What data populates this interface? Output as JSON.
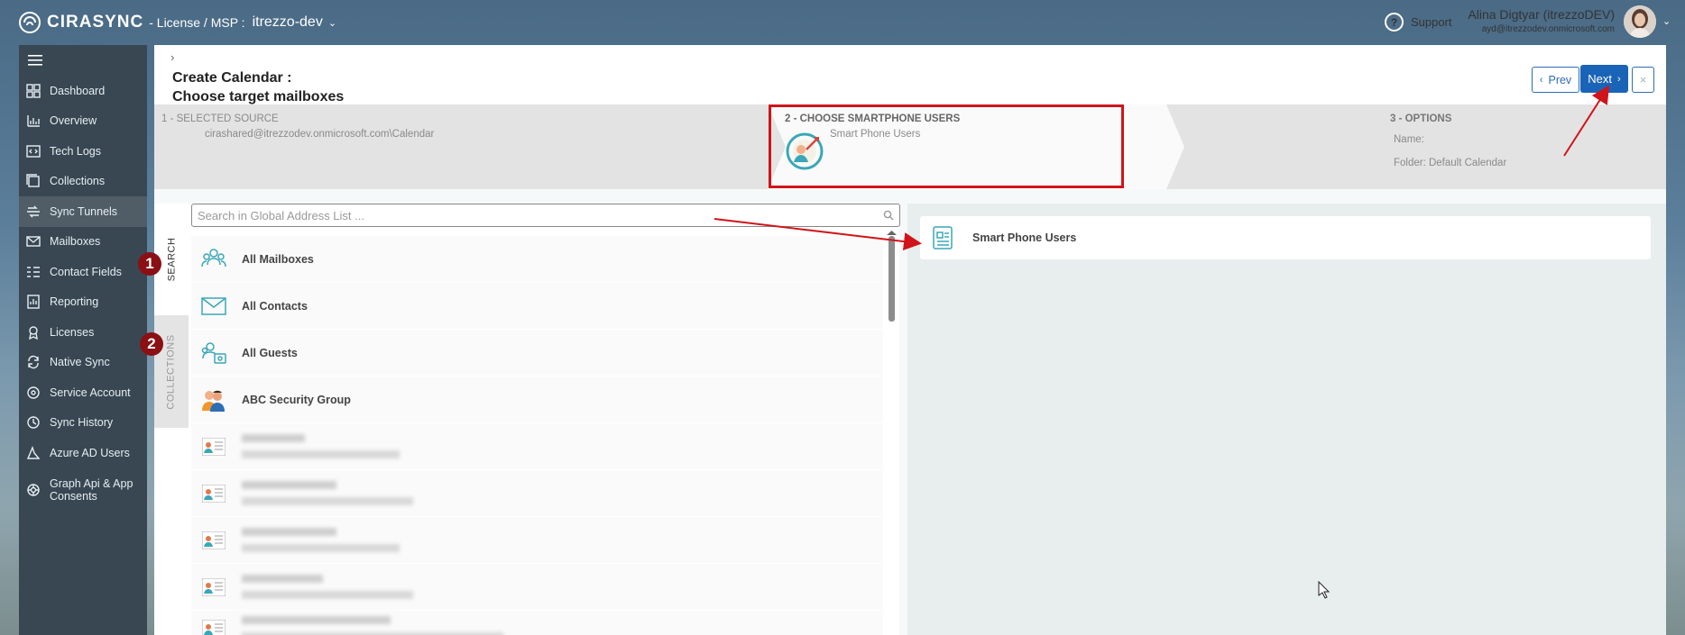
{
  "topbar": {
    "brand": "CIRASYNC",
    "crumb": "- License / MSP :",
    "tenant": "itrezzo-dev",
    "support": "Support",
    "user_name": "Alina Digtyar (itrezzoDEV)",
    "user_email": "ayd@itrezzodev.onmicrosoft.com"
  },
  "sidebar": {
    "items": [
      {
        "label": "Dashboard",
        "icon": "dashboard-icon"
      },
      {
        "label": "Overview",
        "icon": "bar-chart-icon"
      },
      {
        "label": "Tech Logs",
        "icon": "code-icon"
      },
      {
        "label": "Collections",
        "icon": "collections-icon"
      },
      {
        "label": "Sync Tunnels",
        "icon": "sync-tunnel-icon",
        "active": true
      },
      {
        "label": "Mailboxes",
        "icon": "envelope-icon"
      },
      {
        "label": "Contact Fields",
        "icon": "fields-icon"
      },
      {
        "label": "Reporting",
        "icon": "report-icon"
      },
      {
        "label": "Licenses",
        "icon": "license-icon"
      },
      {
        "label": "Native Sync",
        "icon": "native-sync-icon"
      },
      {
        "label": "Service Account",
        "icon": "service-account-icon"
      },
      {
        "label": "Sync History",
        "icon": "history-icon"
      },
      {
        "label": "Azure AD Users",
        "icon": "azure-users-icon"
      },
      {
        "label": "Graph Api & App Consents",
        "icon": "graph-api-icon"
      }
    ]
  },
  "header": {
    "breadcrumb_arrow": "›",
    "title_line1": "Create Calendar  :",
    "title_line2": "Choose target mailboxes",
    "prev_label": "Prev",
    "next_label": "Next",
    "close_label": "×"
  },
  "steps": [
    {
      "label": "1 - SELECTED SOURCE",
      "value": "cirashared@itrezzodev.onmicrosoft.com\\Calendar"
    },
    {
      "label": "2 - CHOOSE SMARTPHONE USERS",
      "value": "Smart Phone Users"
    },
    {
      "label": "3 - OPTIONS",
      "name": "Name:",
      "folder": "Folder: Default Calendar"
    }
  ],
  "left_panel": {
    "tab_search": "SEARCH",
    "tab_collections": "COLLECTIONS",
    "search_placeholder": "Search in Global Address List ...",
    "rows": [
      {
        "label": "All Mailboxes",
        "icon": "users-group-icon"
      },
      {
        "label": "All Contacts",
        "icon": "envelope-icon"
      },
      {
        "label": "All Guests",
        "icon": "guests-icon"
      },
      {
        "label": "ABC Security Group",
        "icon": "security-group-icon"
      }
    ]
  },
  "right_panel": {
    "selected_item": "Smart Phone Users"
  },
  "annotations": {
    "badge1": "1",
    "badge2": "2"
  }
}
